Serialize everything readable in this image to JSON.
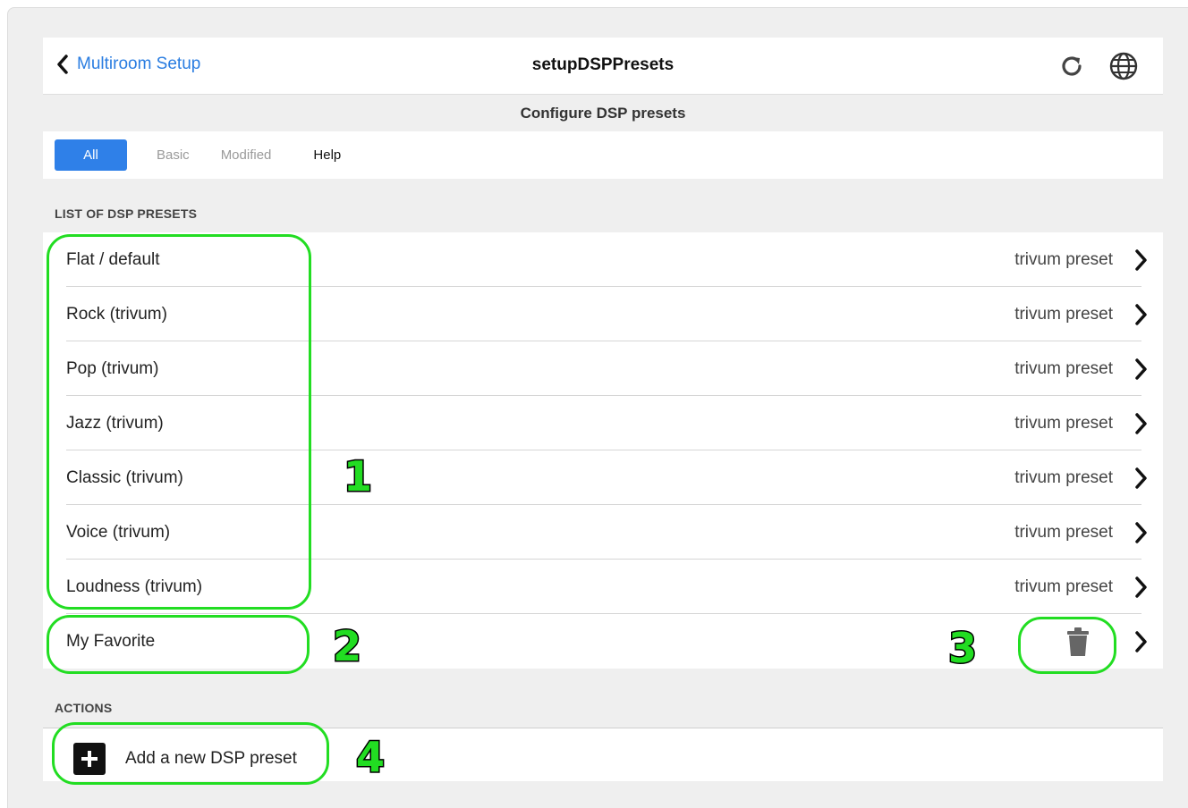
{
  "nav": {
    "back_label": "Multiroom Setup",
    "title": "setupDSPPresets",
    "icons": [
      "refresh-icon",
      "globe-icon"
    ]
  },
  "subtitle": "Configure DSP presets",
  "tabs": [
    {
      "label": "All",
      "active": true
    },
    {
      "label": "Basic",
      "active": false
    },
    {
      "label": "Modified",
      "active": false
    },
    {
      "label": "Help",
      "active": false
    }
  ],
  "list_section_label": "LIST OF DSP PRESETS",
  "presets": [
    {
      "name": "Flat / default",
      "tag": "trivum preset"
    },
    {
      "name": "Rock (trivum)",
      "tag": "trivum preset"
    },
    {
      "name": "Pop (trivum)",
      "tag": "trivum preset"
    },
    {
      "name": "Jazz (trivum)",
      "tag": "trivum preset"
    },
    {
      "name": "Classic (trivum)",
      "tag": "trivum preset"
    },
    {
      "name": "Voice (trivum)",
      "tag": "trivum preset"
    },
    {
      "name": "Loudness (trivum)",
      "tag": "trivum preset"
    }
  ],
  "custom_preset": {
    "name": "My Favorite",
    "icon": "trash-icon"
  },
  "actions_section_label": "ACTIONS",
  "add_action_label": "Add a new DSP preset",
  "annotations": [
    "1",
    "2",
    "3",
    "4"
  ],
  "colors": {
    "accent": "#2f80e8",
    "link": "#2a7de1",
    "highlight": "#22dd22"
  }
}
